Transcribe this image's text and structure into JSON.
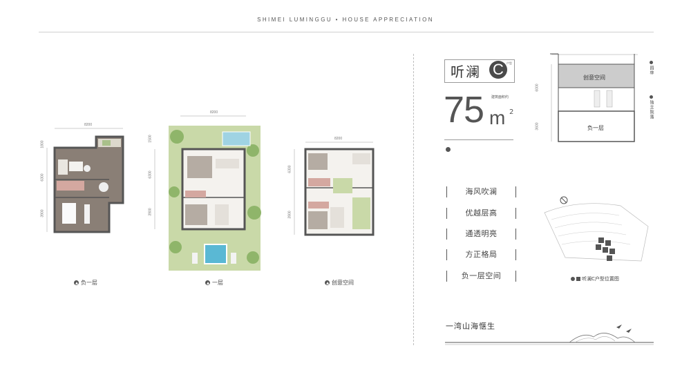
{
  "header": {
    "title": "SHIMEI LUMINGGU • HOUSE APPRECIATION"
  },
  "plans": {
    "basement": {
      "caption": "负一层",
      "dim_top": "8200",
      "dims_left": [
        "1800",
        "6300",
        "3900"
      ]
    },
    "first_floor": {
      "caption": "一层",
      "dim_top": "8200",
      "dims_left": [
        "1500",
        "6300",
        "3900"
      ]
    },
    "creative": {
      "caption": "创意空间",
      "dim_top": "8200",
      "dims_left": [
        "6300",
        "3900"
      ]
    }
  },
  "unit": {
    "name": "听澜",
    "type_letter": "C",
    "type_suffix": "户型",
    "area_label": "建筑面积约",
    "area_value": "75",
    "area_unit": "m",
    "area_sup": "2"
  },
  "features": [
    "海风吹澜",
    "优越层高",
    "通透明亮",
    "方正格局",
    "负一层空间"
  ],
  "section": {
    "upper_label": "创意空间",
    "lower_label": "负一层",
    "dim_upper": "6000",
    "dim_lower": "3600",
    "side_label_1": "园林",
    "side_label_2": "独立院落"
  },
  "site_plan": {
    "legend": "听澜C户型位置图"
  },
  "logo": {
    "text": "一湾山海惬生"
  },
  "colors": {
    "wall": "#5a5a5a",
    "floor": "#8a7f76",
    "grass": "#c9d9a8",
    "pool": "#9fd3e3",
    "section_fill": "#cccccc"
  }
}
